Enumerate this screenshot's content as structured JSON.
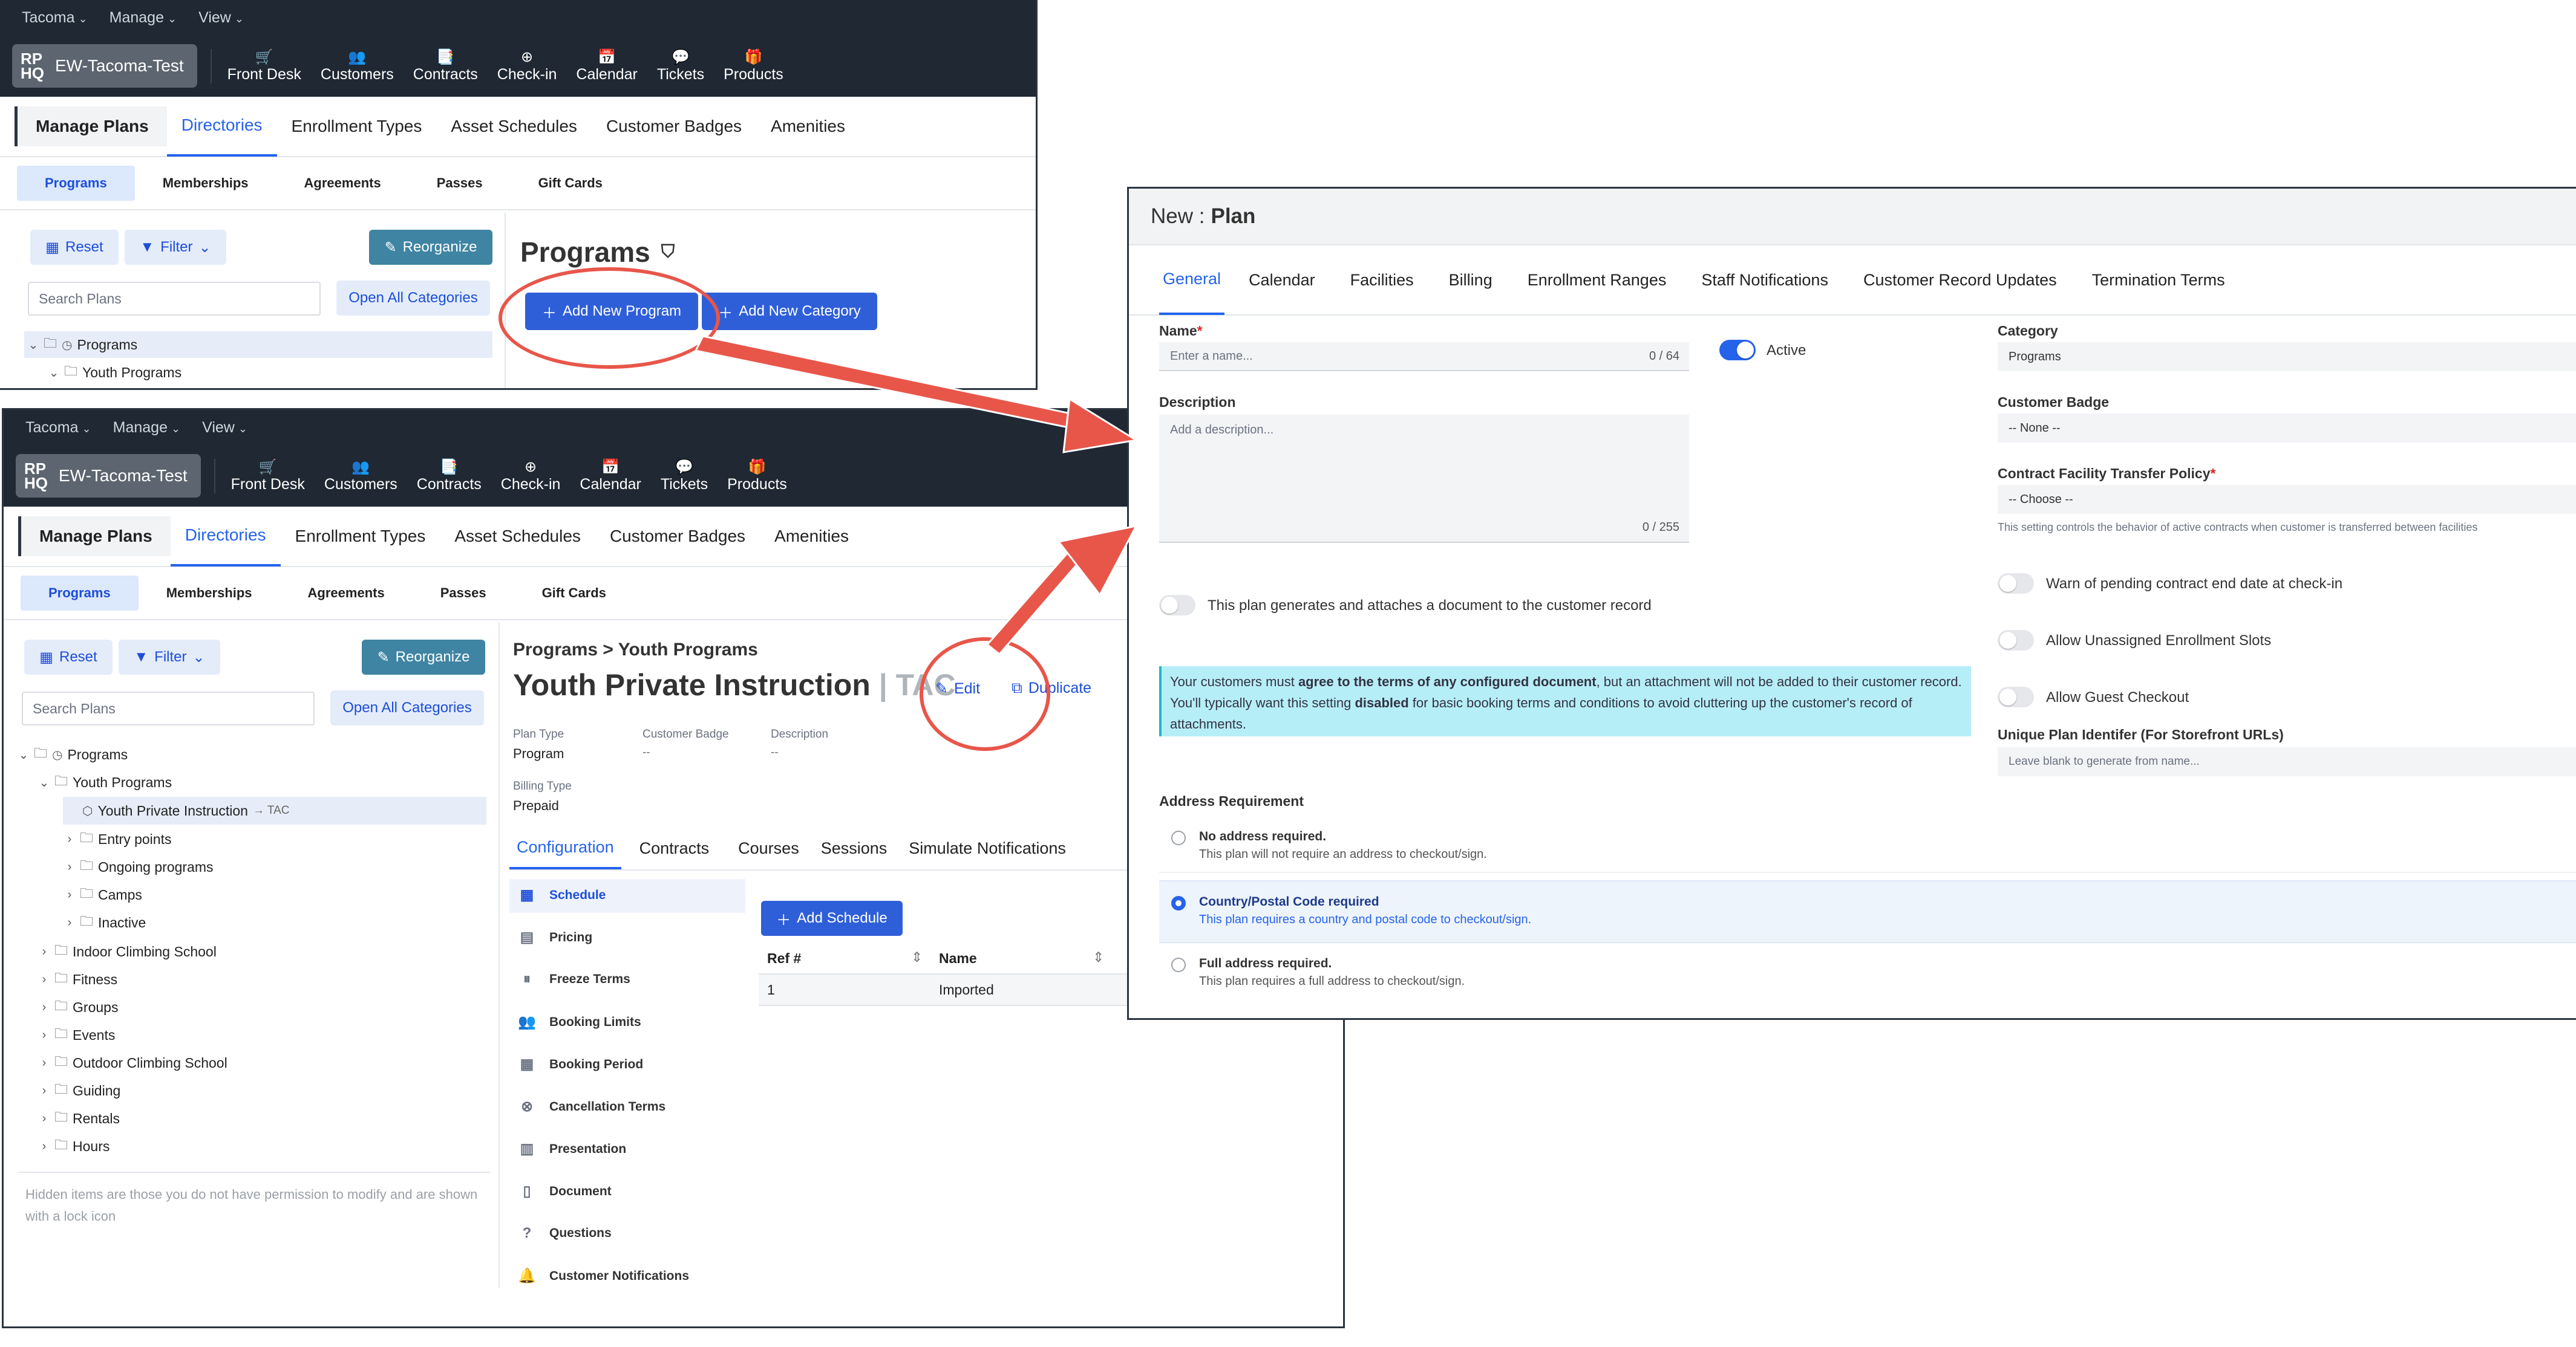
{
  "top_menu": [
    "Tacoma",
    "Manage",
    "View"
  ],
  "brand": {
    "logo": "RP HQ",
    "name": "EW-Tacoma-Test"
  },
  "nav": [
    {
      "icon": "cart-icon",
      "glyph": "🛒",
      "label": "Front Desk"
    },
    {
      "icon": "users-icon",
      "glyph": "👥",
      "label": "Customers"
    },
    {
      "icon": "contracts-icon",
      "glyph": "📑",
      "label": "Contracts"
    },
    {
      "icon": "checkin-icon",
      "glyph": "⊕",
      "label": "Check-in"
    },
    {
      "icon": "calendar-icon",
      "glyph": "📅",
      "label": "Calendar"
    },
    {
      "icon": "tickets-icon",
      "glyph": "💬",
      "label": "Tickets"
    },
    {
      "icon": "products-icon",
      "glyph": "🎁",
      "label": "Products"
    }
  ],
  "main_nav": {
    "manage_plans": "Manage Plans",
    "tabs": [
      "Directories",
      "Enrollment Types",
      "Asset Schedules",
      "Customer Badges",
      "Amenities"
    ]
  },
  "sub_nav": [
    "Programs",
    "Memberships",
    "Agreements",
    "Passes",
    "Gift Cards"
  ],
  "toolbar": {
    "reset": "Reset",
    "filter": "Filter",
    "reorganize": "Reorganize",
    "search_placeholder": "Search Plans",
    "open_all": "Open All Categories"
  },
  "win1": {
    "heading": "Programs",
    "add_program": "Add New Program",
    "add_category": "Add New Category",
    "tree": [
      "Programs",
      "Youth Programs"
    ]
  },
  "win2": {
    "breadcrumb": "Programs > Youth Programs",
    "title": "Youth Private Instruction",
    "title_suffix": "| TAC",
    "edit": "Edit",
    "duplicate": "Duplicate",
    "meta": {
      "plan_type_label": "Plan Type",
      "plan_type": "Program",
      "badge_label": "Customer Badge",
      "badge": "--",
      "description_label": "Description",
      "description": "--",
      "billing_type_label": "Billing Type",
      "billing_type": "Prepaid"
    },
    "tabs": [
      "Configuration",
      "Contracts",
      "Courses",
      "Sessions",
      "Simulate Notifications"
    ],
    "side_menu": [
      {
        "icon": "calendar-icon",
        "glyph": "▦",
        "label": "Schedule"
      },
      {
        "icon": "pricing-icon",
        "glyph": "▤",
        "label": "Pricing"
      },
      {
        "icon": "freeze-icon",
        "glyph": "⏸",
        "label": "Freeze Terms"
      },
      {
        "icon": "limits-icon",
        "glyph": "👥",
        "label": "Booking Limits"
      },
      {
        "icon": "period-icon",
        "glyph": "▦",
        "label": "Booking Period"
      },
      {
        "icon": "cancel-icon",
        "glyph": "⊗",
        "label": "Cancellation Terms"
      },
      {
        "icon": "presentation-icon",
        "glyph": "▥",
        "label": "Presentation"
      },
      {
        "icon": "document-icon",
        "glyph": "▯",
        "label": "Document"
      },
      {
        "icon": "questions-icon",
        "glyph": "?",
        "label": "Questions"
      },
      {
        "icon": "bell-icon",
        "glyph": "🔔",
        "label": "Customer Notifications"
      }
    ],
    "add_schedule": "Add Schedule",
    "table": {
      "headers": [
        "Ref #",
        "Name"
      ],
      "rows": [
        [
          "1",
          "Imported"
        ]
      ]
    },
    "tree": [
      {
        "label": "Programs",
        "level": 0,
        "open": true
      },
      {
        "label": "Youth Programs",
        "level": 1,
        "open": true
      },
      {
        "label": "Youth Private Instruction",
        "suffix": "→ TAC",
        "level": 2,
        "selected": true
      },
      {
        "label": "Entry points",
        "level": 2
      },
      {
        "label": "Ongoing programs",
        "level": 2
      },
      {
        "label": "Camps",
        "level": 2
      },
      {
        "label": "Inactive",
        "level": 2
      },
      {
        "label": "Indoor Climbing School",
        "level": 1
      },
      {
        "label": "Fitness",
        "level": 1
      },
      {
        "label": "Groups",
        "level": 1
      },
      {
        "label": "Events",
        "level": 1
      },
      {
        "label": "Outdoor Climbing School",
        "level": 1
      },
      {
        "label": "Guiding",
        "level": 1
      },
      {
        "label": "Rentals",
        "level": 1
      },
      {
        "label": "Hours",
        "level": 1
      }
    ],
    "hidden_note": "Hidden items are those you do not have permission to modify and are shown with a lock icon"
  },
  "win3": {
    "title_prefix": "New :",
    "title": "Plan",
    "tabs": [
      "General",
      "Calendar",
      "Facilities",
      "Billing",
      "Enrollment Ranges",
      "Staff Notifications",
      "Customer Record Updates",
      "Termination Terms"
    ],
    "name_label": "Name",
    "name_placeholder": "Enter a name...",
    "name_counter": "0 / 64",
    "active_label": "Active",
    "description_label": "Description",
    "description_placeholder": "Add a description...",
    "description_counter": "0 / 255",
    "category_label": "Category",
    "category_value": "Programs",
    "badge_label": "Customer Badge",
    "badge_value": "-- None --",
    "transfer_label": "Contract Facility Transfer Policy",
    "transfer_value": "-- Choose --",
    "transfer_help": "This setting controls the behavior of active contracts when customer is transferred between facilities",
    "doc_toggle_label": "This plan generates and attaches a document to the customer record",
    "warn_label": "Warn of pending contract end date at check-in",
    "unassigned_label": "Allow Unassigned Enrollment Slots",
    "guest_label": "Allow Guest Checkout",
    "info_box": {
      "p1": "Your customers must ",
      "b1": "agree to the terms of any configured document",
      "p2": ", but an attachment will not be added to their customer record. You'll typically want this setting ",
      "b2": "disabled",
      "p3": " for basic booking terms and conditions to avoid cluttering up the customer's record of attachments."
    },
    "uid_label": "Unique Plan Identifer (For Storefront URLs)",
    "uid_placeholder": "Leave blank to generate from name...",
    "address_label": "Address Requirement",
    "address_options": [
      {
        "title": "No address required.",
        "desc": "This plan will not require an address to checkout/sign.",
        "selected": false
      },
      {
        "title": "Country/Postal Code required",
        "desc": "This plan requires a country and postal code to checkout/sign.",
        "selected": true
      },
      {
        "title": "Full address required.",
        "desc": "This plan requires a full address to checkout/sign.",
        "selected": false
      }
    ]
  },
  "colors": {
    "accent": "#2563eb",
    "nav_bg": "#1f2833",
    "annotation": "#e8564a",
    "info_bg": "#b6eef7"
  }
}
